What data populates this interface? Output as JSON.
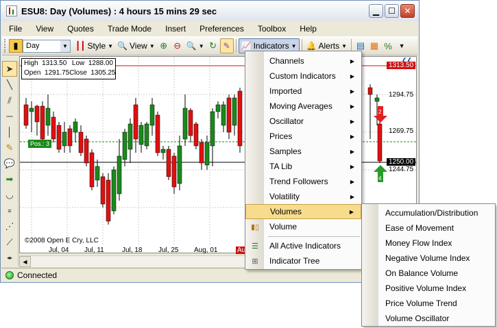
{
  "window": {
    "title": "ESU8: Day (Volumes) : 4 hours 15 mins 29 sec"
  },
  "menubar": [
    "File",
    "View",
    "Quotes",
    "Trade Mode",
    "Insert",
    "Preferences",
    "Toolbox",
    "Help"
  ],
  "toolbar": {
    "period_value": "Day",
    "style_label": "Style",
    "view_label": "View",
    "indicators_label": "Indicators",
    "alerts_label": "Alerts"
  },
  "ohlc": {
    "high_label": "High",
    "high": "1313.50",
    "low_label": "Low",
    "low": "1288.00",
    "open_label": "Open",
    "open": "1291.75",
    "close_label": "Close",
    "close": "1305.25"
  },
  "chart": {
    "copyright": "©2008 Open E Cry, LLC",
    "pos_label": "Pos.: 3",
    "x_labels": [
      "Jul, 04",
      "Jul, 11",
      "Jul, 18",
      "Jul, 25",
      "Aug, 01",
      "Au"
    ],
    "price_labels": [
      "1294.75",
      "1269.75",
      "1244.75"
    ],
    "price_high_box": "1313.50",
    "price_last_box": "1250.00",
    "arrow_down_label": "2",
    "arrow_up_label": "4"
  },
  "indicators_menu": {
    "items": [
      {
        "label": "Channels",
        "submenu": true
      },
      {
        "label": "Custom Indicators",
        "submenu": true
      },
      {
        "label": "Imported",
        "submenu": true
      },
      {
        "label": "Moving Averages",
        "submenu": true
      },
      {
        "label": "Oscillator",
        "submenu": true
      },
      {
        "label": "Prices",
        "submenu": true
      },
      {
        "label": "Samples",
        "submenu": true
      },
      {
        "label": "TA Lib",
        "submenu": true
      },
      {
        "label": "Trend Followers",
        "submenu": true
      },
      {
        "label": "Volatility",
        "submenu": true
      },
      {
        "label": "Volumes",
        "submenu": true,
        "highlighted": true
      },
      {
        "label": "Volume",
        "submenu": false
      },
      {
        "label": "All Active Indicators",
        "submenu": false
      },
      {
        "label": "Indicator Tree",
        "submenu": false
      }
    ]
  },
  "volumes_submenu": [
    "Accumulation/Distribution",
    "Ease of Movement",
    "Money Flow Index",
    "Negative Volume Index",
    "On Balance Volume",
    "Positive Volume Index",
    "Price Volume Trend",
    "Volume Oscillator"
  ],
  "status": {
    "text": "Connected"
  },
  "colors": {
    "up": "#1a8a1a",
    "down": "#e01010",
    "highlight": "#f8dc8e",
    "accent_red": "#d01010"
  }
}
